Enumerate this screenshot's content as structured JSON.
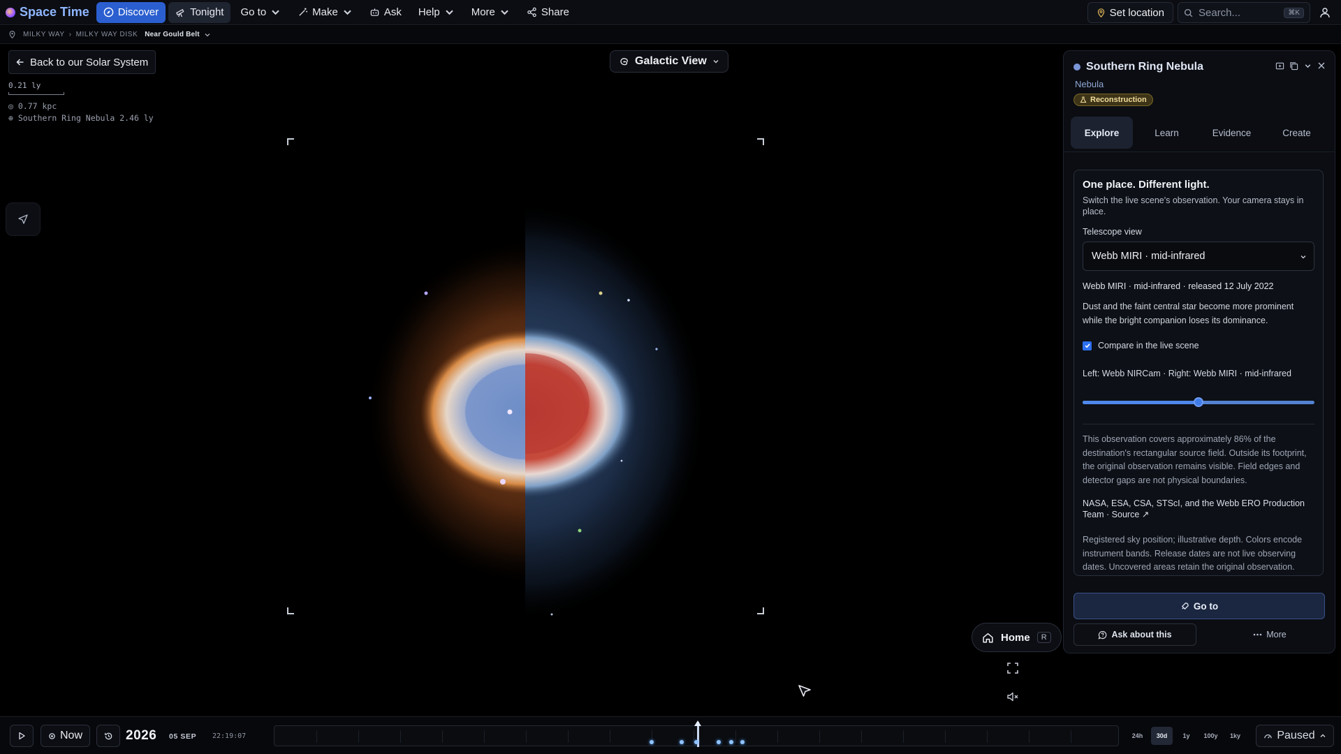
{
  "app": {
    "name": "Space Time"
  },
  "nav": {
    "discover": "Discover",
    "tonight": "Tonight",
    "goto": "Go to",
    "make": "Make",
    "ask": "Ask",
    "help": "Help",
    "more": "More",
    "share": "Share"
  },
  "top_right": {
    "set_location": "Set location",
    "search_placeholder": "Search...",
    "search_shortcut": "⌘K"
  },
  "breadcrumb": {
    "items": [
      "MILKY WAY",
      "MILKY WAY DISK"
    ],
    "separator": "›",
    "current": "Near Gould Belt"
  },
  "scene": {
    "back_button": "Back to our Solar System",
    "scale_label": "0.21 ly",
    "readout_distance": "0.77 kpc",
    "readout_target": "Southern Ring Nebula 2.46 ly",
    "view_selector": "Galactic View",
    "home_button": "Home",
    "home_shortcut": "R"
  },
  "panel": {
    "title": "Southern Ring Nebula",
    "object_type": "Nebula",
    "badge": "Reconstruction",
    "tabs": [
      "Explore",
      "Learn",
      "Evidence",
      "Create"
    ],
    "active_tab": "Explore",
    "card": {
      "heading": "One place. Different light.",
      "subheading": "Switch the live scene's observation. Your camera stays in place.",
      "telescope_label": "Telescope view",
      "telescope_selected": "Webb MIRI · mid-infrared",
      "release_info": "Webb MIRI · mid-infrared · released 12 July 2022",
      "description": "Dust and the faint central star become more prominent while the bright companion loses its dominance.",
      "compare_checkbox_label": "Compare in the live scene",
      "compare_checked": true,
      "compare_caption": "Left: Webb NIRCam · Right: Webb MIRI · mid-infrared",
      "compare_slider_fraction": 0.5,
      "coverage_text": "This observation covers approximately 86% of the destination's rectangular source field. Outside its footprint, the original observation remains visible. Field edges and detector gaps are not physical boundaries.",
      "credit": "NASA, ESA, CSA, STScI, and the Webb ERO Production Team · Source ↗",
      "note": "Registered sky position; illustrative depth. Colors encode instrument bands. Release dates are not live observing dates. Uncovered areas retain the original observation."
    },
    "go_to_button": "Go to",
    "ask_button": "Ask about this",
    "more_button": "More"
  },
  "timeline": {
    "now_button": "Now",
    "year": "2026",
    "date": "05 SEP",
    "time": "22:19:07",
    "ranges": [
      "24h",
      "30d",
      "1y",
      "100y",
      "1ky"
    ],
    "active_range": "30d",
    "status": "Paused"
  },
  "colors": {
    "accent": "#2b5fd0",
    "brand": "#8fb6ff",
    "badge_bg": "#3d3418",
    "badge_text": "#f1dc9a",
    "timeline_dot": "#8fc3ff"
  }
}
